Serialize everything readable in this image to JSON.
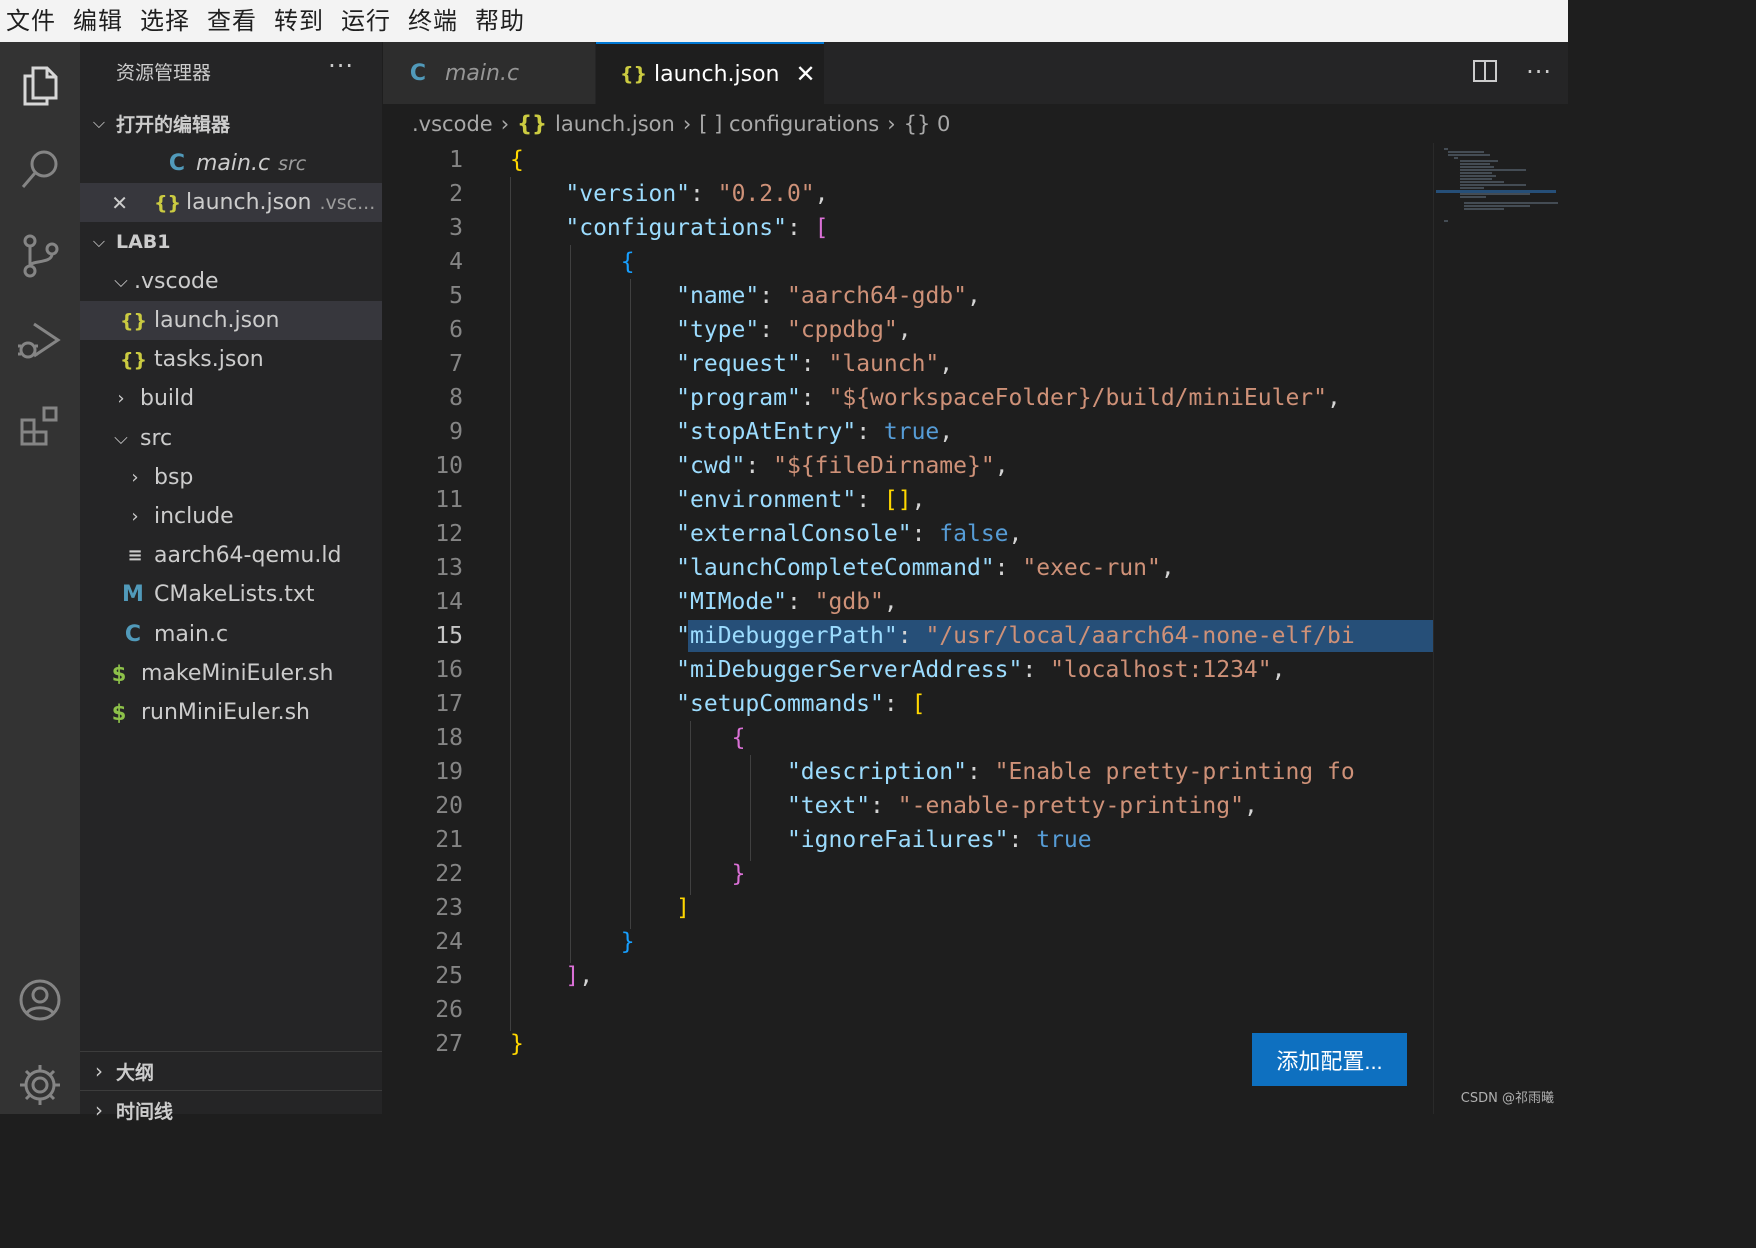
{
  "menu": [
    "文件",
    "编辑",
    "选择",
    "查看",
    "转到",
    "运行",
    "终端",
    "帮助"
  ],
  "explorer": {
    "title": "资源管理器",
    "more": "···",
    "open_editors": {
      "title": "打开的编辑器",
      "items": [
        {
          "icon": "C",
          "name": "main.c",
          "detail": "src"
        },
        {
          "icon": "{}",
          "name": "launch.json",
          "detail": ".vsc..."
        }
      ]
    },
    "workspace": {
      "title": "LAB1",
      "items": [
        {
          "name": ".vscode"
        },
        {
          "icon": "{}",
          "name": "launch.json"
        },
        {
          "icon": "{}",
          "name": "tasks.json"
        },
        {
          "name": "build"
        },
        {
          "name": "src"
        },
        {
          "name": "bsp"
        },
        {
          "name": "include"
        },
        {
          "icon": "≡",
          "name": "aarch64-qemu.ld"
        },
        {
          "icon": "M",
          "name": "CMakeLists.txt"
        },
        {
          "icon": "C",
          "name": "main.c"
        },
        {
          "icon": "$",
          "name": "makeMiniEuler.sh"
        },
        {
          "icon": "$",
          "name": "runMiniEuler.sh"
        }
      ]
    },
    "outline_title": "大纲",
    "timeline_title": "时间线"
  },
  "tabs": [
    {
      "icon": "C",
      "label": "main.c"
    },
    {
      "icon": "{}",
      "label": "launch.json",
      "close": "✕"
    }
  ],
  "breadcrumb": [
    ".vscode",
    "{} launch.json",
    "[ ] configurations",
    "{} 0"
  ],
  "code_lines": [
    "1",
    "2",
    "3",
    "4",
    "5",
    "6",
    "7",
    "8",
    "9",
    "10",
    "11",
    "12",
    "13",
    "14",
    "15",
    "16",
    "17",
    "18",
    "19",
    "20",
    "21",
    "22",
    "23",
    "24",
    "25",
    "26",
    "27"
  ],
  "code": {
    "l2k": "\"version\"",
    "l2v": "\"0.2.0\"",
    "l3k": "\"configurations\"",
    "l5k": "\"name\"",
    "l5v": "\"aarch64-gdb\"",
    "l6k": "\"type\"",
    "l6v": "\"cppdbg\"",
    "l7k": "\"request\"",
    "l7v": "\"launch\"",
    "l8k": "\"program\"",
    "l8v": "\"${workspaceFolder}/build/miniEuler\"",
    "l9k": "\"stopAtEntry\"",
    "l9v": "true",
    "l10k": "\"cwd\"",
    "l10v": "\"${fileDirname}\"",
    "l11k": "\"environment\"",
    "l12k": "\"externalConsole\"",
    "l12v": "false",
    "l13k": "\"launchCompleteCommand\"",
    "l13v": "\"exec-run\"",
    "l14k": "\"MIMode\"",
    "l14v": "\"gdb\"",
    "l15k": "\"miDebuggerPath\"",
    "l15v": "\"/usr/local/aarch64-none-elf/bi",
    "l16k": "\"miDebuggerServerAddress\"",
    "l16v": "\"localhost:1234\"",
    "l17k": "\"setupCommands\"",
    "l19k": "\"description\"",
    "l19v": "\"Enable pretty-printing fo",
    "l20k": "\"text\"",
    "l20v": "\"-enable-pretty-printing\"",
    "l21k": "\"ignoreFailures\"",
    "l21v": "true"
  },
  "add_config_button": "添加配置...",
  "watermark": "CSDN @祁雨曦",
  "colors": {
    "accent": "#0078d4",
    "button": "#0e70c0",
    "selection": "#264f78"
  }
}
